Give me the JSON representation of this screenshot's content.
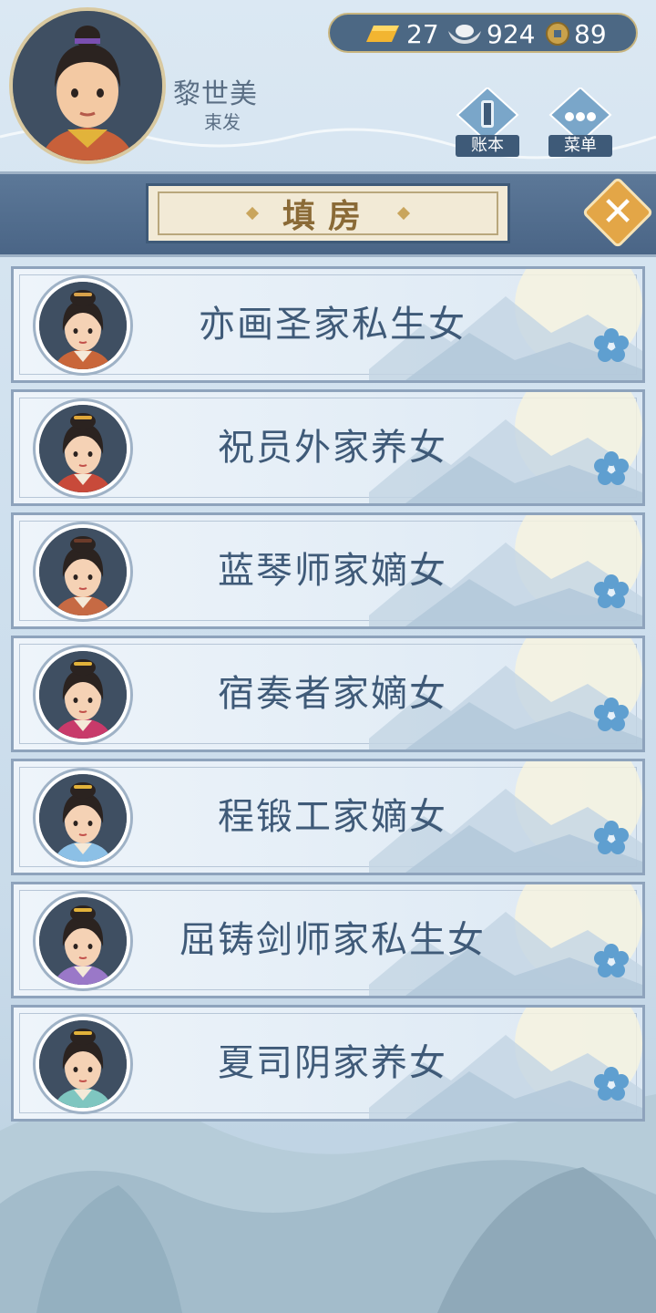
{
  "player": {
    "name": "黎世美",
    "title": "束发"
  },
  "currency": {
    "gold": "27",
    "silver": "924",
    "coins": "89"
  },
  "buttons": {
    "ledger": "账本",
    "menu": "菜单"
  },
  "page_title": "填房",
  "candidates": [
    {
      "name": "亦画圣家私生女",
      "garment": "#c9663a",
      "accent": "#d8a24a"
    },
    {
      "name": "祝员外家养女",
      "garment": "#c84a3a",
      "accent": "#e0a83a"
    },
    {
      "name": "蓝琴师家嫡女",
      "garment": "#c66a44",
      "accent": "#6b3b2a"
    },
    {
      "name": "宿奏者家嫡女",
      "garment": "#c83a6a",
      "accent": "#e2b23a"
    },
    {
      "name": "程锻工家嫡女",
      "garment": "#8cc0e6",
      "accent": "#e2b23a"
    },
    {
      "name": "屈铸剑师家私生女",
      "garment": "#9a78c8",
      "accent": "#e2b23a"
    },
    {
      "name": "夏司阴家养女",
      "garment": "#7fc6c0",
      "accent": "#e2b23a"
    }
  ],
  "colors": {
    "banner": "#4a6586",
    "text": "#3f5a78",
    "close": "#e3a647"
  }
}
